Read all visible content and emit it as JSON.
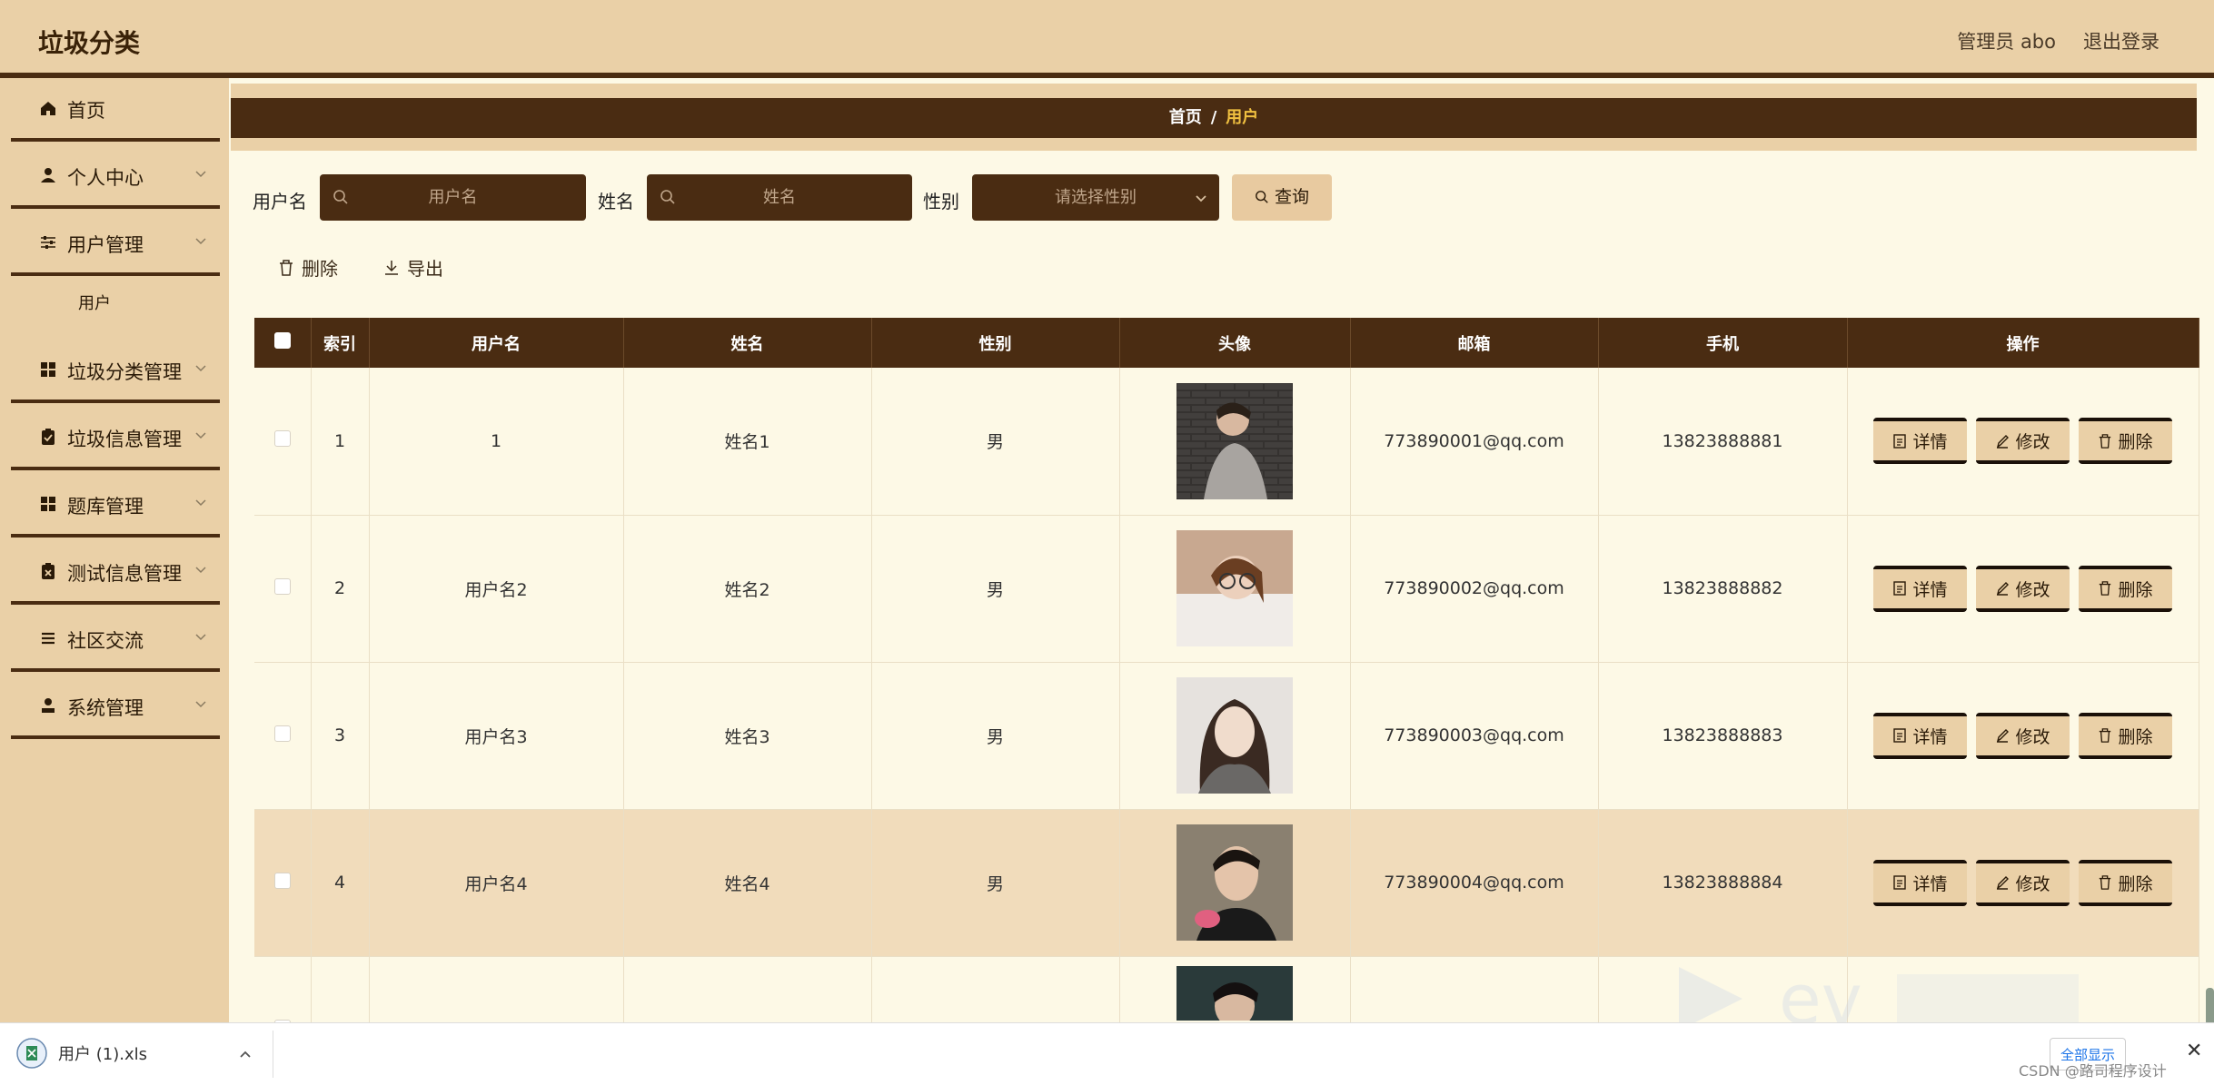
{
  "app": {
    "title": "垃圾分类"
  },
  "header": {
    "admin_label": "管理员 abo",
    "logout_label": "退出登录"
  },
  "sidebar": {
    "items": [
      {
        "label": "首页",
        "icon": "home-icon"
      },
      {
        "label": "个人中心",
        "icon": "user-icon"
      },
      {
        "label": "用户管理",
        "icon": "sliders-icon"
      },
      {
        "label": "垃圾分类管理",
        "icon": "grid-icon"
      },
      {
        "label": "垃圾信息管理",
        "icon": "clipboard-icon"
      },
      {
        "label": "题库管理",
        "icon": "grid-icon"
      },
      {
        "label": "测试信息管理",
        "icon": "clipboard-x-icon"
      },
      {
        "label": "社区交流",
        "icon": "list-icon"
      },
      {
        "label": "系统管理",
        "icon": "person-icon"
      }
    ],
    "sub_item": "用户"
  },
  "breadcrumb": {
    "home": "首页",
    "sep": "/",
    "current": "用户"
  },
  "search": {
    "username_label": "用户名",
    "username_placeholder": "用户名",
    "name_label": "姓名",
    "name_placeholder": "姓名",
    "gender_label": "性别",
    "gender_placeholder": "请选择性别",
    "query_label": "查询"
  },
  "actions": {
    "delete_label": "删除",
    "export_label": "导出"
  },
  "table": {
    "headers": [
      "索引",
      "用户名",
      "姓名",
      "性别",
      "头像",
      "邮箱",
      "手机",
      "操作"
    ],
    "rows": [
      {
        "index": "1",
        "username": "1",
        "name": "姓名1",
        "gender": "男",
        "email": "773890001@qq.com",
        "phone": "13823888881"
      },
      {
        "index": "2",
        "username": "用户名2",
        "name": "姓名2",
        "gender": "男",
        "email": "773890002@qq.com",
        "phone": "13823888882"
      },
      {
        "index": "3",
        "username": "用户名3",
        "name": "姓名3",
        "gender": "男",
        "email": "773890003@qq.com",
        "phone": "13823888883"
      },
      {
        "index": "4",
        "username": "用户名4",
        "name": "姓名4",
        "gender": "男",
        "email": "773890004@qq.com",
        "phone": "13823888884"
      }
    ],
    "op_detail": "详情",
    "op_edit": "修改",
    "op_delete": "删除"
  },
  "download": {
    "filename": "用户 (1).xls",
    "show_all": "全部显示"
  },
  "watermark": "CSDN @路司程序设计",
  "colors": {
    "dark_brown": "#4a2c12",
    "tan": "#ead0a7",
    "cream": "#fdf9e6",
    "highlight": "#f1dcbb",
    "accent_yellow": "#f0c040"
  }
}
